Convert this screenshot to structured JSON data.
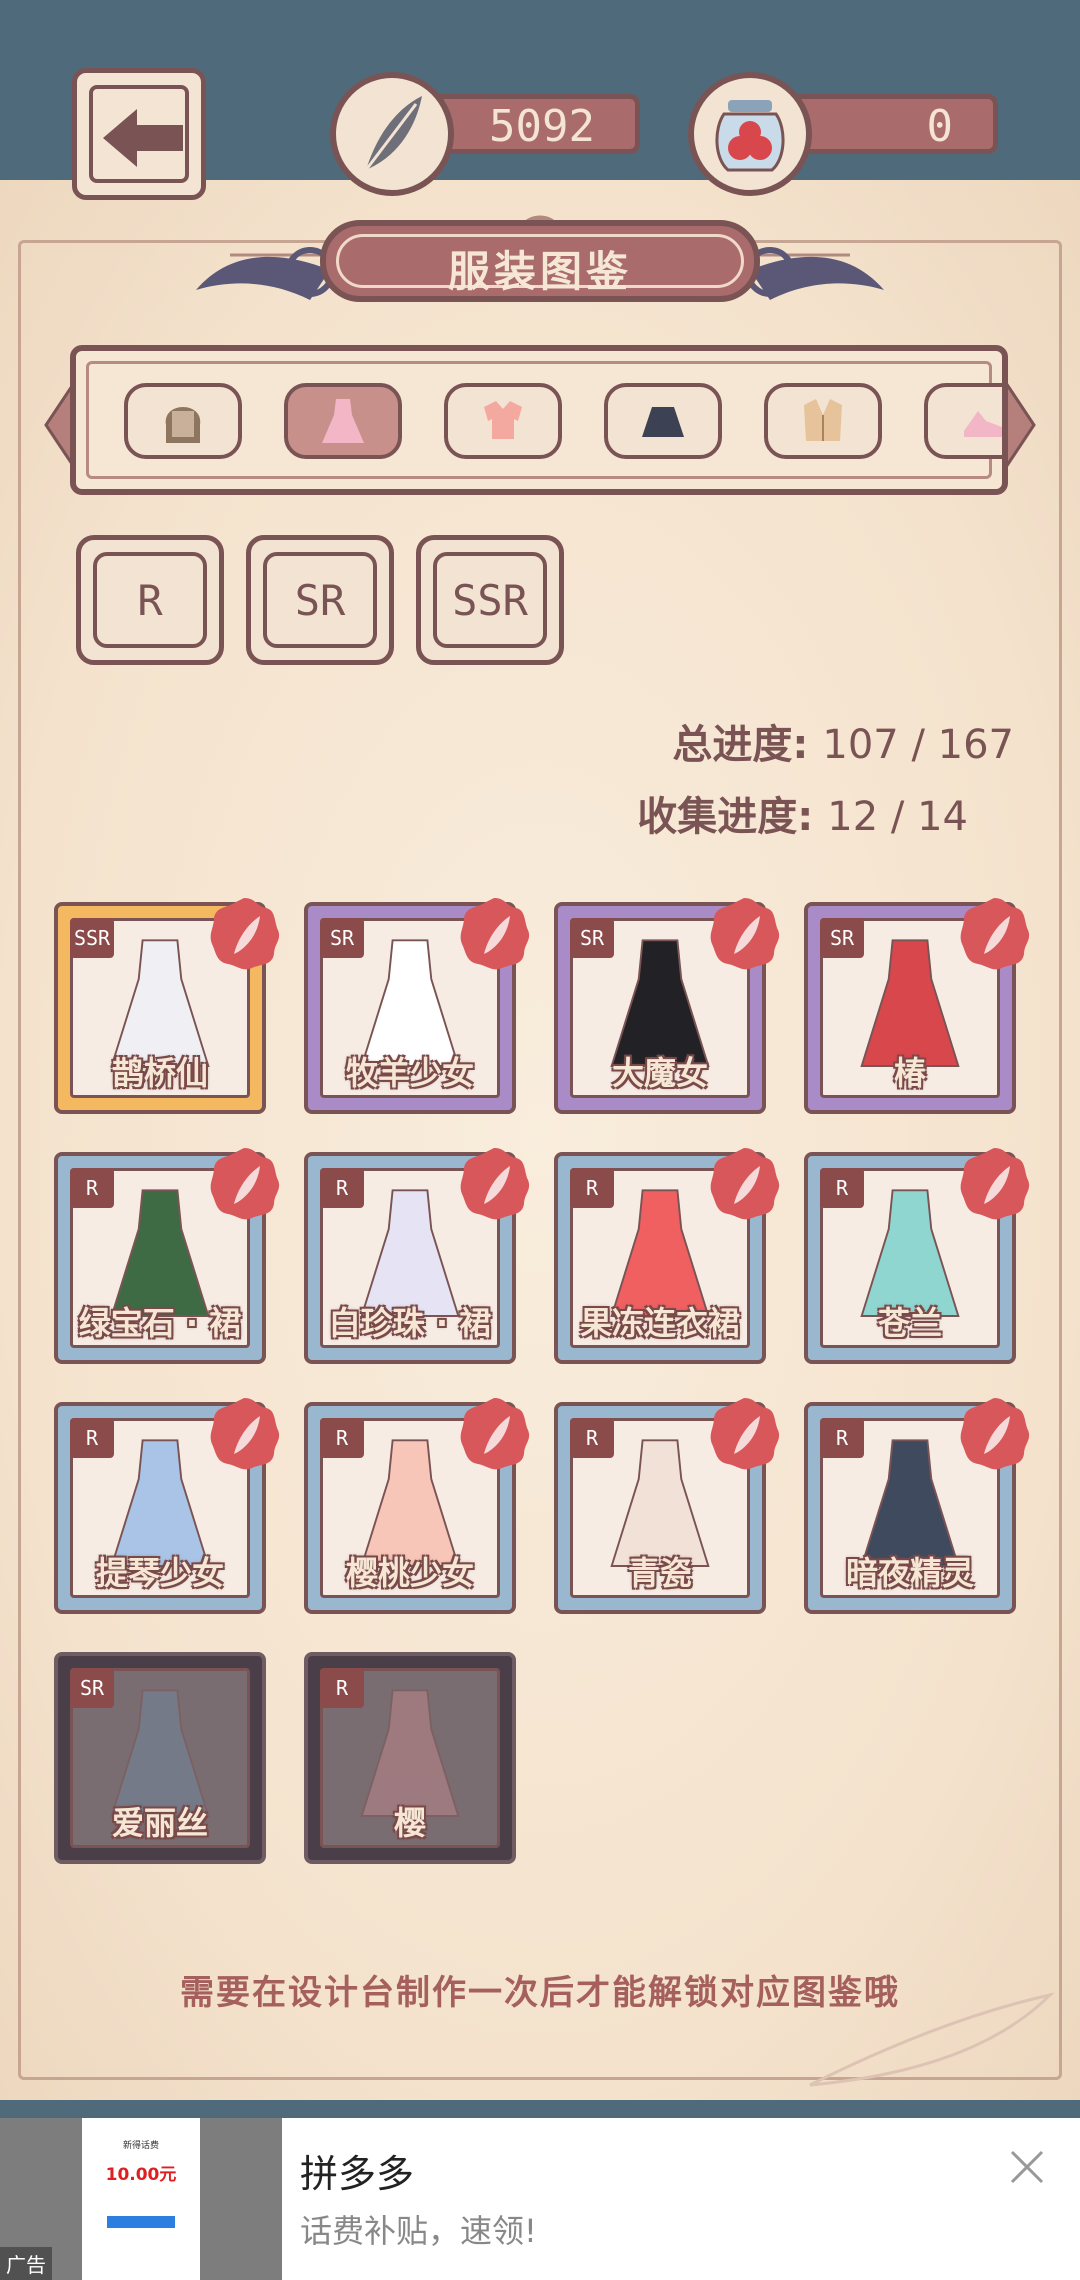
{
  "header": {
    "feather_count": "5092",
    "jar_count": "0"
  },
  "title": "服装图鉴",
  "categories": [
    {
      "icon": "wig-icon",
      "active": false
    },
    {
      "icon": "dress-icon",
      "active": true
    },
    {
      "icon": "top-icon",
      "active": false
    },
    {
      "icon": "skirt-icon",
      "active": false
    },
    {
      "icon": "jacket-icon",
      "active": false
    },
    {
      "icon": "shoe-icon",
      "active": false
    }
  ],
  "rarity_filters": [
    "R",
    "SR",
    "SSR"
  ],
  "progress": {
    "total_label": "总进度:",
    "total_value": "107 / 167",
    "collect_label": "收集进度:",
    "collect_value": "12 / 14"
  },
  "cards": [
    {
      "name": "鹊桥仙",
      "rarity": "SSR",
      "locked": false
    },
    {
      "name": "牧羊少女",
      "rarity": "SR",
      "locked": false
    },
    {
      "name": "大魔女",
      "rarity": "SR",
      "locked": false
    },
    {
      "name": "椿",
      "rarity": "SR",
      "locked": false
    },
    {
      "name": "绿宝石 · 裙",
      "rarity": "R",
      "locked": false
    },
    {
      "name": "白珍珠 · 裙",
      "rarity": "R",
      "locked": false
    },
    {
      "name": "果冻连衣裙",
      "rarity": "R",
      "locked": false
    },
    {
      "name": "苍兰",
      "rarity": "R",
      "locked": false
    },
    {
      "name": "提琴少女",
      "rarity": "R",
      "locked": false
    },
    {
      "name": "樱桃少女",
      "rarity": "R",
      "locked": false
    },
    {
      "name": "青瓷",
      "rarity": "R",
      "locked": false
    },
    {
      "name": "暗夜精灵",
      "rarity": "R",
      "locked": false
    },
    {
      "name": "爱丽丝",
      "rarity": "SR",
      "locked": true
    },
    {
      "name": "樱",
      "rarity": "R",
      "locked": true
    }
  ],
  "hint": "需要在设计台制作一次后才能解锁对应图鉴哦",
  "ad": {
    "thumb_caption": "新得话费",
    "thumb_amount": "10.00元",
    "label": "广告",
    "title": "拼多多",
    "subtitle": "话费补贴，速领!"
  },
  "colors": {
    "accent": "#7a5454",
    "panel": "#f6e7d5",
    "seal": "#d8575a"
  }
}
